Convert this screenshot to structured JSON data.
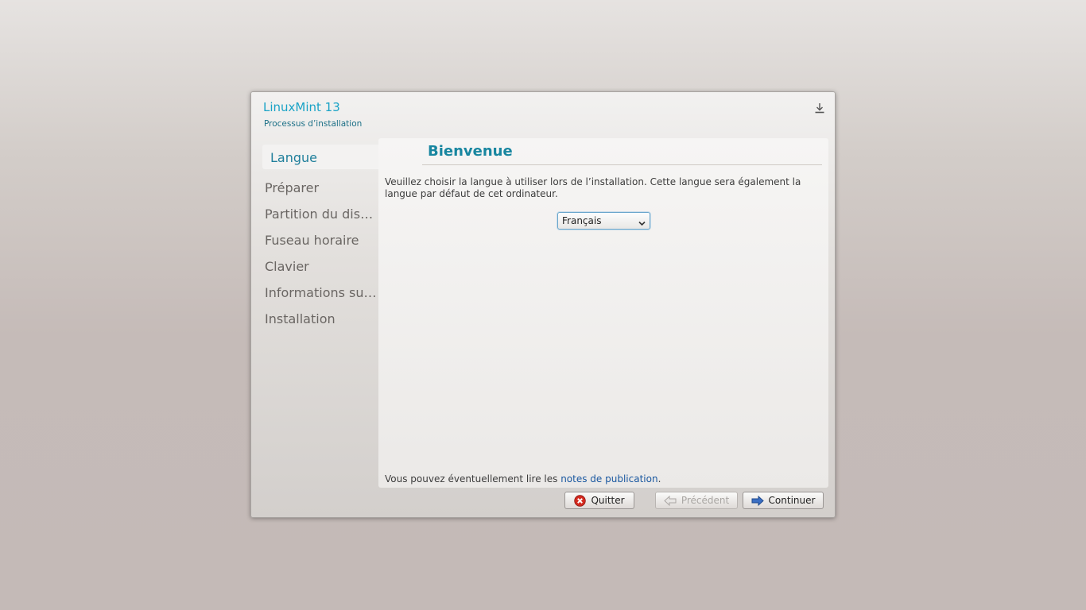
{
  "window": {
    "title": "LinuxMint 13",
    "subtitle": "Processus d’installation",
    "icon": "download-icon"
  },
  "sidebar": {
    "items": [
      {
        "label": "Langue",
        "active": true
      },
      {
        "label": "Préparer"
      },
      {
        "label": "Partition du disque"
      },
      {
        "label": "Fuseau horaire"
      },
      {
        "label": "Clavier"
      },
      {
        "label": "Informations sur vous"
      },
      {
        "label": "Installation"
      }
    ]
  },
  "content": {
    "heading": "Bienvenue",
    "intro": "Veuillez choisir la langue à utiliser lors de l’installation. Cette langue sera également la langue par défaut de cet ordinateur.",
    "language_select": {
      "value": "Français",
      "icon": "chevron-down-icon"
    },
    "notes_prefix": "Vous pouvez éventuellement lire les ",
    "notes_link": "notes de publication",
    "notes_suffix": "."
  },
  "buttons": {
    "quit": {
      "label": "Quitter",
      "icon": "close-circle-icon"
    },
    "previous": {
      "label": "Précédent",
      "icon": "arrow-left-icon",
      "disabled": true
    },
    "continue": {
      "label": "Continuer",
      "icon": "arrow-right-icon"
    }
  },
  "colors": {
    "accent": "#1886a0",
    "title": "#1aa3c6",
    "link": "#1a58a0",
    "quit_icon": "#d42b20",
    "continue_icon": "#3b6fc4"
  }
}
